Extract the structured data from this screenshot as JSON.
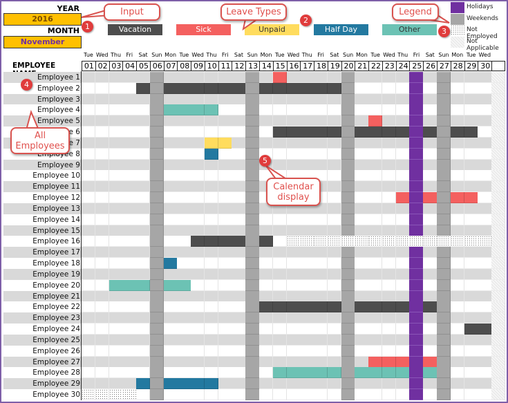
{
  "inputs": {
    "year_label": "YEAR",
    "year_value": "2016",
    "month_label": "MONTH",
    "month_value": "November"
  },
  "leave_types": [
    {
      "key": "vacation",
      "label": "Vacation",
      "color": "#4d4d4d",
      "text_color": "#ffffff"
    },
    {
      "key": "sick",
      "label": "Sick",
      "color": "#f4605f",
      "text_color": "#ffffff"
    },
    {
      "key": "unpaid",
      "label": "Unpaid",
      "color": "#ffdc5e",
      "text_color": "#333333"
    },
    {
      "key": "halfday",
      "label": "Half Day",
      "color": "#2379a0",
      "text_color": "#ffffff"
    },
    {
      "key": "other",
      "label": "Other",
      "color": "#6cc2b4",
      "text_color": "#333333"
    }
  ],
  "legend": [
    {
      "label": "Holidays",
      "color": "#7030a0"
    },
    {
      "label": "Weekends",
      "color": "#a6a6a6"
    },
    {
      "label": "Not Employed",
      "pattern": "dots"
    },
    {
      "label": "Not Applicable",
      "pattern": "hatch"
    }
  ],
  "callouts": {
    "input": "Input",
    "leave_types": "Leave Types",
    "legend": "Legend",
    "all_employees": "All Employees",
    "calendar_display": "Calendar display"
  },
  "markers": [
    "1",
    "2",
    "3",
    "4",
    "5"
  ],
  "calendar": {
    "header_label": "EMPLOYEE NAME",
    "days": [
      "01",
      "02",
      "03",
      "04",
      "05",
      "06",
      "07",
      "08",
      "09",
      "10",
      "11",
      "12",
      "13",
      "14",
      "15",
      "16",
      "17",
      "18",
      "19",
      "20",
      "21",
      "22",
      "23",
      "24",
      "25",
      "26",
      "27",
      "28",
      "29",
      "30"
    ],
    "weekdays": [
      "Tue",
      "Wed",
      "Thu",
      "Fri",
      "Sat",
      "Sun",
      "Mon",
      "Tue",
      "Wed",
      "Thu",
      "Fri",
      "Sat",
      "Sun",
      "Mon",
      "Tue",
      "Wed",
      "Thu",
      "Fri",
      "Sat",
      "Sun",
      "Mon",
      "Tue",
      "Wed",
      "Thu",
      "Fri",
      "Sat",
      "Sun",
      "Mon",
      "Tue",
      "Wed"
    ],
    "weekend_days": [
      6,
      13,
      20,
      27
    ],
    "holidays": [
      25
    ],
    "not_applicable_days": [
      31
    ],
    "employees": [
      {
        "name": "Employee 1",
        "leaves": {
          "sick": [
            15
          ]
        }
      },
      {
        "name": "Employee 2",
        "leaves": {
          "vacation": [
            5,
            7,
            8,
            9,
            10,
            11,
            12,
            14,
            15,
            16,
            17,
            18,
            19
          ]
        }
      },
      {
        "name": "Employee 3",
        "leaves": {}
      },
      {
        "name": "Employee 4",
        "leaves": {
          "other": [
            7,
            8,
            9,
            10
          ]
        }
      },
      {
        "name": "Employee 5",
        "leaves": {
          "sick": [
            22
          ]
        }
      },
      {
        "name": "Employee 6",
        "leaves": {
          "vacation": [
            15,
            16,
            17,
            18,
            19,
            21,
            22,
            23,
            24,
            26,
            28,
            29
          ]
        }
      },
      {
        "name": "Employee 7",
        "leaves": {
          "unpaid": [
            10,
            11
          ]
        }
      },
      {
        "name": "Employee 8",
        "leaves": {
          "halfday": [
            10
          ]
        }
      },
      {
        "name": "Employee 9",
        "leaves": {}
      },
      {
        "name": "Employee 10",
        "leaves": {}
      },
      {
        "name": "Employee 11",
        "leaves": {}
      },
      {
        "name": "Employee 12",
        "leaves": {
          "sick": [
            24,
            26,
            28,
            29
          ]
        }
      },
      {
        "name": "Employee 13",
        "leaves": {}
      },
      {
        "name": "Employee 14",
        "leaves": {}
      },
      {
        "name": "Employee 15",
        "leaves": {}
      },
      {
        "name": "Employee 16",
        "leaves": {
          "vacation": [
            9,
            10,
            11,
            12,
            14
          ]
        },
        "not_employed": [
          16,
          17,
          18,
          19,
          20,
          21,
          22,
          23,
          24,
          25,
          26,
          27,
          28,
          29,
          30
        ]
      },
      {
        "name": "Employee 17",
        "leaves": {}
      },
      {
        "name": "Employee 18",
        "leaves": {
          "halfday": [
            7
          ]
        }
      },
      {
        "name": "Employee 19",
        "leaves": {}
      },
      {
        "name": "Employee 20",
        "leaves": {
          "other": [
            3,
            4,
            5,
            7,
            8
          ]
        }
      },
      {
        "name": "Employee 21",
        "leaves": {}
      },
      {
        "name": "Employee 22",
        "leaves": {
          "vacation": [
            14,
            15,
            16,
            17,
            18,
            19,
            21,
            22,
            23,
            24,
            26
          ]
        }
      },
      {
        "name": "Employee 23",
        "leaves": {}
      },
      {
        "name": "Employee 24",
        "leaves": {
          "vacation": [
            29,
            30
          ]
        }
      },
      {
        "name": "Employee 25",
        "leaves": {}
      },
      {
        "name": "Employee 26",
        "leaves": {}
      },
      {
        "name": "Employee 27",
        "leaves": {
          "sick": [
            22,
            23,
            24,
            26
          ]
        }
      },
      {
        "name": "Employee 28",
        "leaves": {
          "other": [
            15,
            16,
            17,
            18,
            19,
            21,
            22,
            23,
            24,
            26
          ]
        }
      },
      {
        "name": "Employee 29",
        "leaves": {
          "halfday": [
            5,
            7,
            8,
            9,
            10
          ]
        }
      },
      {
        "name": "Employee 30",
        "leaves": {},
        "not_employed": [
          1,
          2,
          3,
          4
        ]
      }
    ]
  },
  "colors": {
    "row_shade": "#d9d9d9",
    "weekend": "#a6a6a6",
    "holiday": "#7030a0",
    "frame": "#7e5fa8",
    "callout": "#d9534f"
  }
}
